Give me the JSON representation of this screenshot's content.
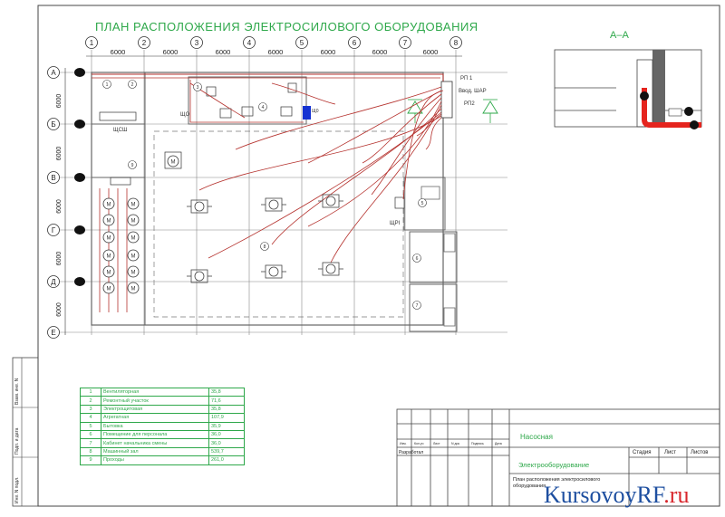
{
  "title": "ПЛАН РАСПОЛОЖЕНИЯ ЭЛЕКТРОСИЛОВОГО ОБОРУДОВАНИЯ",
  "section_label": "А–А",
  "axes": {
    "columns": [
      "1",
      "2",
      "3",
      "4",
      "5",
      "6",
      "7",
      "8"
    ],
    "column_spacing": "6000",
    "rows": [
      "А",
      "Б",
      "В",
      "Г",
      "Д",
      "Е"
    ],
    "row_spacing": "6000"
  },
  "panel_labels": {
    "rp1": "РП 1",
    "vvod": "Ввод. ШАР",
    "rp2": "РП2",
    "shchsh": "ЩСШ",
    "shcho": "ЩО",
    "shr": "ЩРI"
  },
  "legend_rows": [
    {
      "num": "1",
      "name": "Вентиляторная",
      "area": "35,8"
    },
    {
      "num": "2",
      "name": "Ремонтный участок",
      "area": "71,6"
    },
    {
      "num": "3",
      "name": "Электрощитовая",
      "area": "35,8"
    },
    {
      "num": "4",
      "name": "Агрегатная",
      "area": "107,9"
    },
    {
      "num": "5",
      "name": "Бытовка",
      "area": "35,9"
    },
    {
      "num": "6",
      "name": "Помещение для персонала",
      "area": "36,0"
    },
    {
      "num": "7",
      "name": "Кабинет начальника смены",
      "area": "36,0"
    },
    {
      "num": "8",
      "name": "Машинный зал",
      "area": "539,7"
    },
    {
      "num": "9",
      "name": "Проходы",
      "area": "261,0"
    }
  ],
  "title_block": {
    "project": "Насосная",
    "sheet_title": "Электрооборудование",
    "drawing_name": "План расположения электросилового оборудования",
    "stage": "Стадия",
    "sheet": "Лист",
    "sheets": "Листов",
    "developed": "Разработал",
    "col_izm": "Изм.",
    "col_kol": "Кол.уч",
    "col_list": "Лист",
    "col_ndok": "N док",
    "col_podp": "Подпись",
    "col_data": "Дата"
  },
  "side_labels": [
    "Взам. инв. N",
    "Подп. и дата",
    "Инв. N подл."
  ],
  "watermark": {
    "main": "KursovoyRF",
    "tld": ".ru"
  },
  "colors": {
    "green": "#2ea84a",
    "red": "#b5322e",
    "blue": "#1432d2",
    "line": "#555555"
  }
}
